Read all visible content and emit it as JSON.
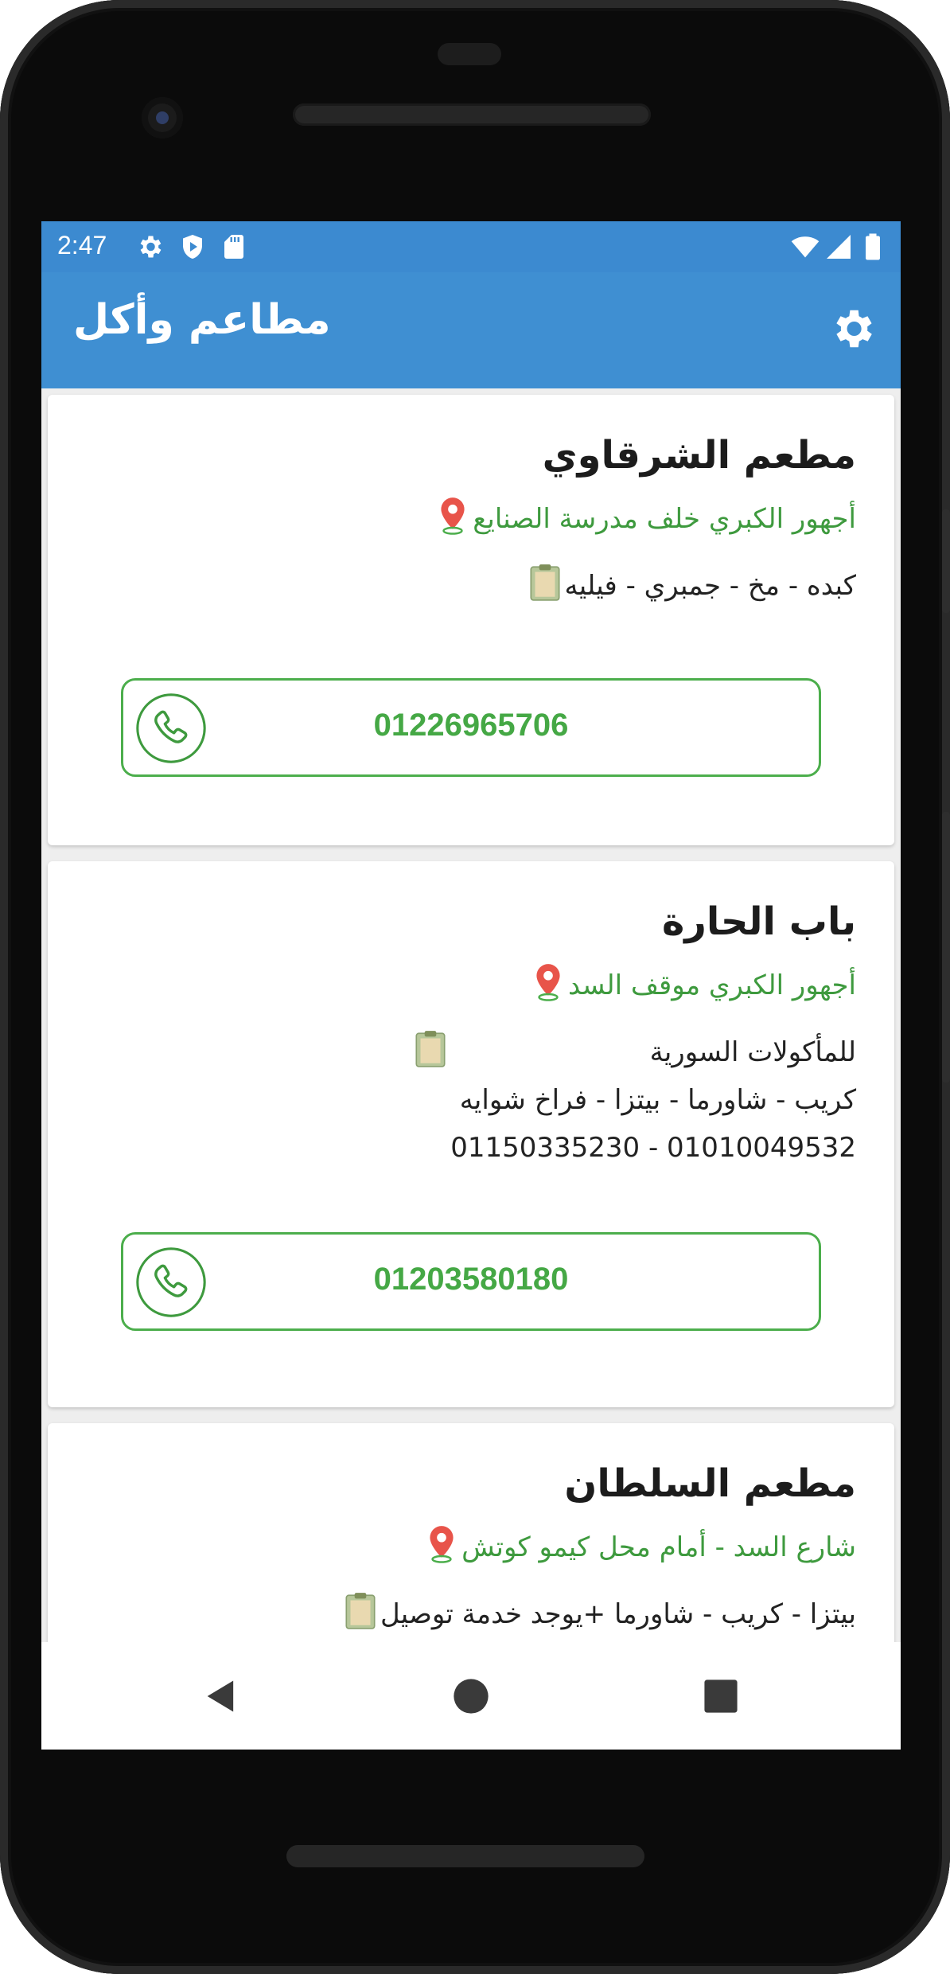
{
  "status_bar": {
    "time": "2:47",
    "left_icons": [
      "gear-icon",
      "play-protect-icon",
      "sd-card-icon"
    ],
    "right_icons": [
      "wifi-icon",
      "signal-icon",
      "battery-icon"
    ]
  },
  "app_bar": {
    "title": "مطاعم وأكل",
    "settings_icon": "gear-icon",
    "color": "#3f8fd2"
  },
  "restaurants": [
    {
      "name": "مطعم الشرقاوي",
      "address": "أجهور الكبري خلف مدرسة الصنايع",
      "description": [
        "كبده - مخ - جمبري - فيليه"
      ],
      "phone": "01226965706"
    },
    {
      "name": "باب الحارة",
      "address": "أجهور الكبري موقف السد",
      "description": [
        "للمأكولات السورية",
        "كريب - شاورما - بيتزا - فراخ شوايه",
        "01010049532 - 01150335230"
      ],
      "phone": "01203580180"
    },
    {
      "name": "مطعم السلطان",
      "address": "شارع السد - أمام محل كيمو كوتش",
      "description": [
        "بيتزا - كريب - شاورما +يوجد خدمة توصيل"
      ],
      "phone": ""
    }
  ],
  "icons": {
    "address": "location-pin-icon",
    "description": "clipboard-icon",
    "call": "phone-icon"
  },
  "colors": {
    "accent_green": "#45a845",
    "address_green": "#3e9a3e",
    "status_bar": "#3c8ad0"
  },
  "nav_bar": {
    "buttons": [
      "back-icon",
      "home-icon",
      "recents-icon"
    ]
  }
}
